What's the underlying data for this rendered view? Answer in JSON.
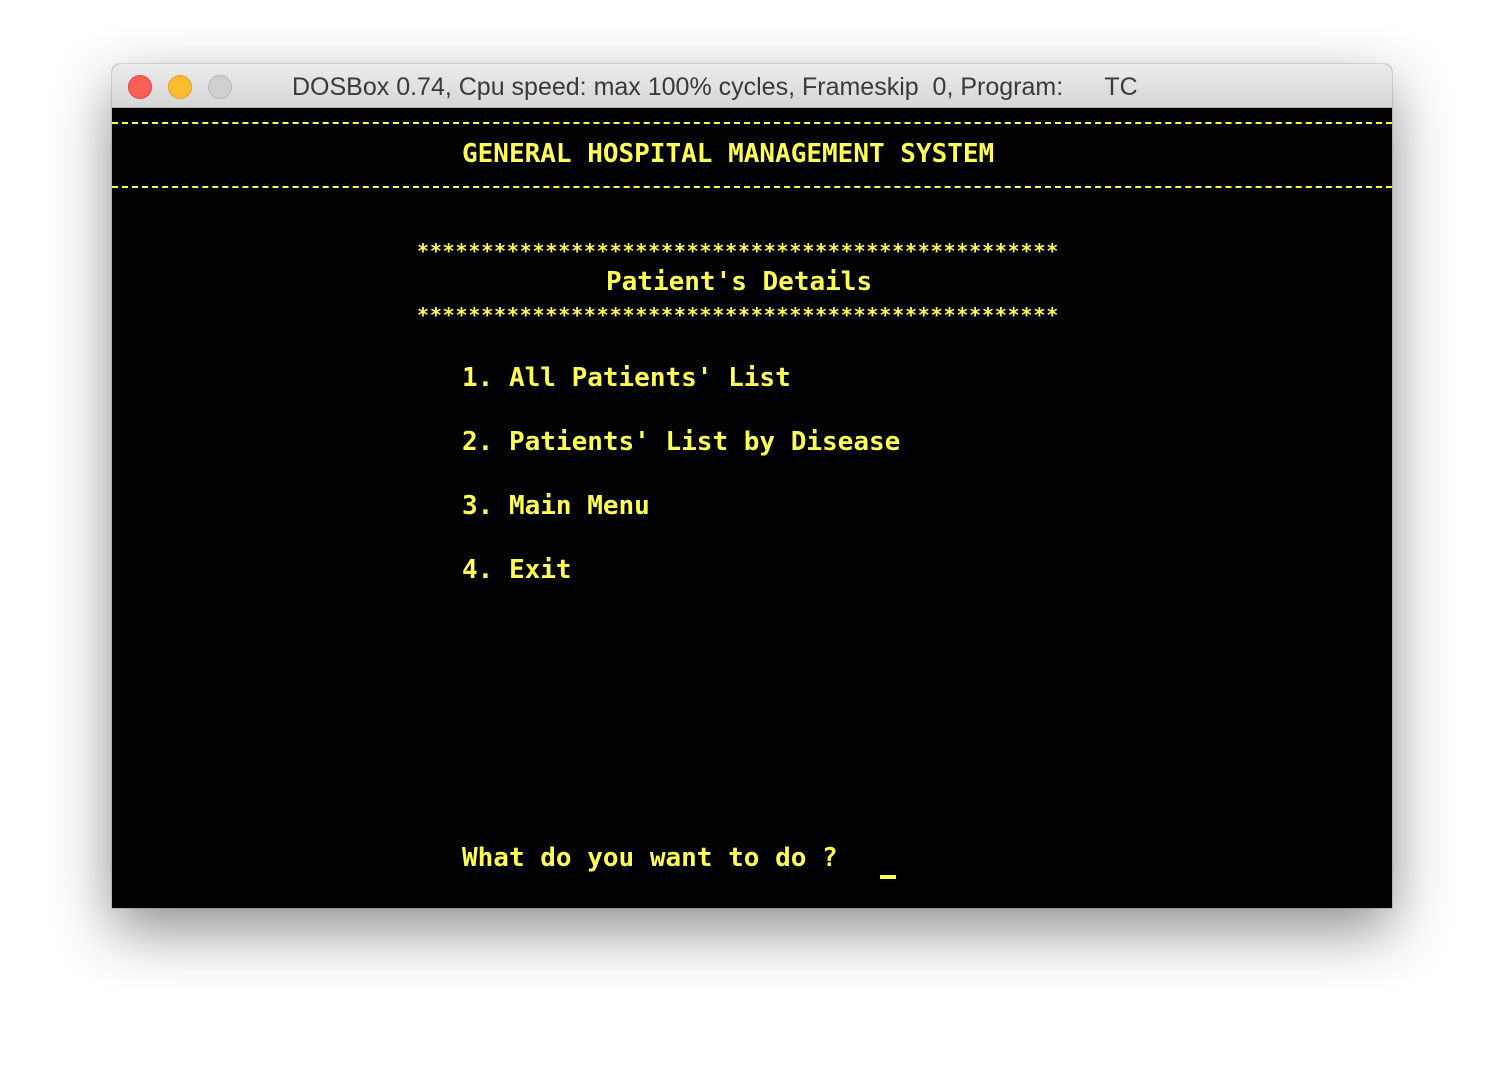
{
  "window": {
    "title": "DOSBox 0.74, Cpu speed: max 100% cycles, Frameskip  0, Program:      TC"
  },
  "screen": {
    "header_title": "GENERAL HOSPITAL MANAGEMENT SYSTEM",
    "star_line": "**************************************************",
    "section_title": "Patient's Details",
    "menu": [
      {
        "label": "1. All Patients' List"
      },
      {
        "label": "2. Patients' List by Disease"
      },
      {
        "label": "3. Main Menu"
      },
      {
        "label": "4. Exit"
      }
    ],
    "prompt": "What do you want to do ?"
  },
  "colors": {
    "text": "#ffff55",
    "background": "#000000"
  }
}
